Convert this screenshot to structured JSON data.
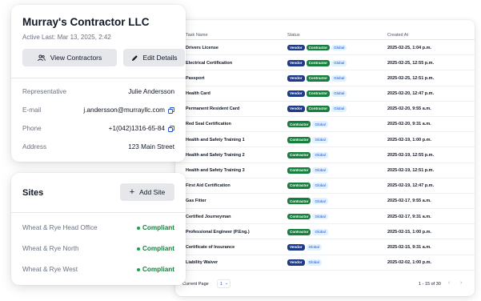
{
  "contractor": {
    "name": "Murray's Contractor LLC",
    "last_active": "Active Last: Mar 13, 2025, 2:42",
    "view_contractors_label": "View Contractors",
    "edit_details_label": "Edit Details",
    "fields": [
      {
        "label": "Representative",
        "value": "Julie Andersson"
      },
      {
        "label": "E-mail",
        "value": "j.andersson@murrayllc.com"
      },
      {
        "label": "Phone",
        "value": "+1(042)1316-65-84"
      },
      {
        "label": "Address",
        "value": "123 Main Street"
      }
    ]
  },
  "sites": {
    "title": "Sites",
    "add_label": "Add Site",
    "items": [
      {
        "name": "Wheat & Rye Head Office",
        "status": "Compliant"
      },
      {
        "name": "Wheat & Rye North",
        "status": "Compliant"
      },
      {
        "name": "Wheat & Rye West",
        "status": "Compliant"
      }
    ]
  },
  "table": {
    "columns": [
      "Task Name",
      "Status",
      "Created At"
    ],
    "rows": [
      {
        "task": "Drivers License",
        "badges": [
          "Vendor",
          "Contractor",
          "Global"
        ],
        "created": "2025-02-25, 1:04 p.m."
      },
      {
        "task": "Electrical Certification",
        "badges": [
          "Vendor",
          "Contractor",
          "Global"
        ],
        "created": "2025-02-25, 12:55 p.m."
      },
      {
        "task": "Passport",
        "badges": [
          "Vendor",
          "Contractor",
          "Global"
        ],
        "created": "2025-02-25, 12:51 p.m."
      },
      {
        "task": "Health Card",
        "badges": [
          "Vendor",
          "Contractor",
          "Global"
        ],
        "created": "2025-02-20, 12:47 p.m."
      },
      {
        "task": "Permanent Resident Card",
        "badges": [
          "Vendor",
          "Contractor",
          "Global"
        ],
        "created": "2025-02-20, 9:55 a.m."
      },
      {
        "task": "Red Seal Certification",
        "badges": [
          "Contractor",
          "Global"
        ],
        "created": "2025-02-20, 9:31 a.m."
      },
      {
        "task": "Health and Safety Training 1",
        "badges": [
          "Contractor",
          "Global"
        ],
        "created": "2025-02-19, 1:00 p.m."
      },
      {
        "task": "Health and Safety Training 2",
        "badges": [
          "Contractor",
          "Global"
        ],
        "created": "2025-02-19, 12:55 p.m."
      },
      {
        "task": "Health and Safety Training 3",
        "badges": [
          "Contractor",
          "Global"
        ],
        "created": "2025-02-19, 12:51 p.m."
      },
      {
        "task": "First Aid Certification",
        "badges": [
          "Contractor",
          "Global"
        ],
        "created": "2025-02-19, 12:47 p.m."
      },
      {
        "task": "Gas Fitter",
        "badges": [
          "Contractor",
          "Global"
        ],
        "created": "2025-02-17, 9:55 a.m."
      },
      {
        "task": "Certified Journeyman",
        "badges": [
          "Contractor",
          "Global"
        ],
        "created": "2025-02-17, 9:31 a.m."
      },
      {
        "task": "Professional Engineer (P.Eng.)",
        "badges": [
          "Contractor",
          "Global"
        ],
        "created": "2025-02-15, 1:00 p.m."
      },
      {
        "task": "Certificate of Insurance",
        "badges": [
          "Vendor",
          "Global"
        ],
        "created": "2025-02-15, 9:31 a.m."
      },
      {
        "task": "Liability Waiver",
        "badges": [
          "Vendor",
          "Global"
        ],
        "created": "2025-02-02, 1:00 p.m."
      }
    ],
    "footer": {
      "current_page_label": "Current Page",
      "current_page_value": "1",
      "range": "1 - 15 of 30"
    }
  },
  "colors": {
    "vendor": "#1e3a8a",
    "contractor": "#15803d",
    "global_bg": "#e0f2fe",
    "compliant": "#15803d"
  },
  "icons": {
    "view_contractors": "users-icon",
    "edit_details": "pencil-icon",
    "add_site": "plus-icon",
    "copy": "copy-icon",
    "prev": "chevron-left-icon",
    "next": "chevron-right-icon"
  }
}
